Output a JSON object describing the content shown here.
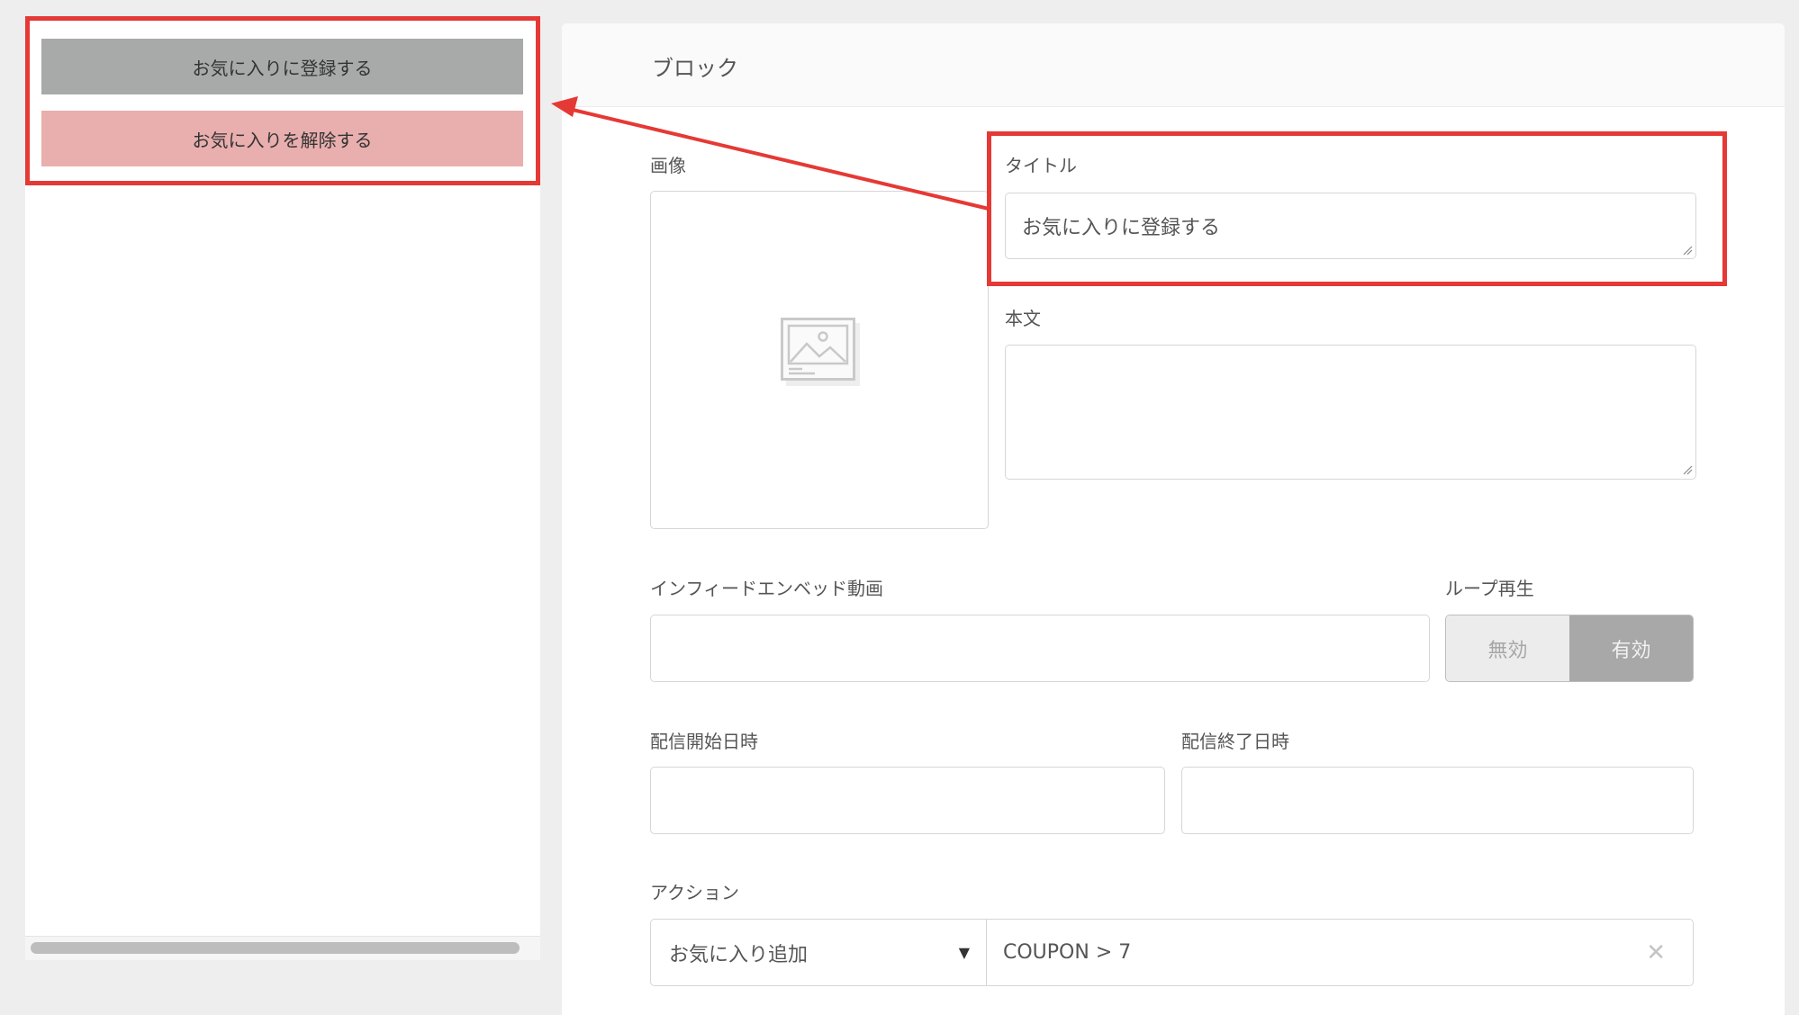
{
  "preview": {
    "register_button": "お気に入りに登録する",
    "unregister_button": "お気に入りを解除する"
  },
  "editor": {
    "title": "ブロック",
    "image_label": "画像",
    "title_label": "タイトル",
    "title_value": "お気に入りに登録する",
    "body_label": "本文",
    "body_value": "",
    "embed_label": "インフィードエンベッド動画",
    "embed_value": "",
    "loop_label": "ループ再生",
    "loop_off": "無効",
    "loop_on": "有効",
    "start_label": "配信開始日時",
    "start_value": "",
    "end_label": "配信終了日時",
    "end_value": "",
    "action_label": "アクション",
    "action_selected": "お気に入り追加",
    "action_value": "COUPON > 7"
  },
  "icons": {
    "image_placeholder": "image-placeholder-icon",
    "select_caret": "caret-down-icon",
    "clear": "clear-icon"
  },
  "colors": {
    "highlight": "#e53935",
    "register_button_bg": "#a8aaa9",
    "unregister_button_bg": "#e9aeae",
    "toggle_active_bg": "#a8a8a8"
  }
}
